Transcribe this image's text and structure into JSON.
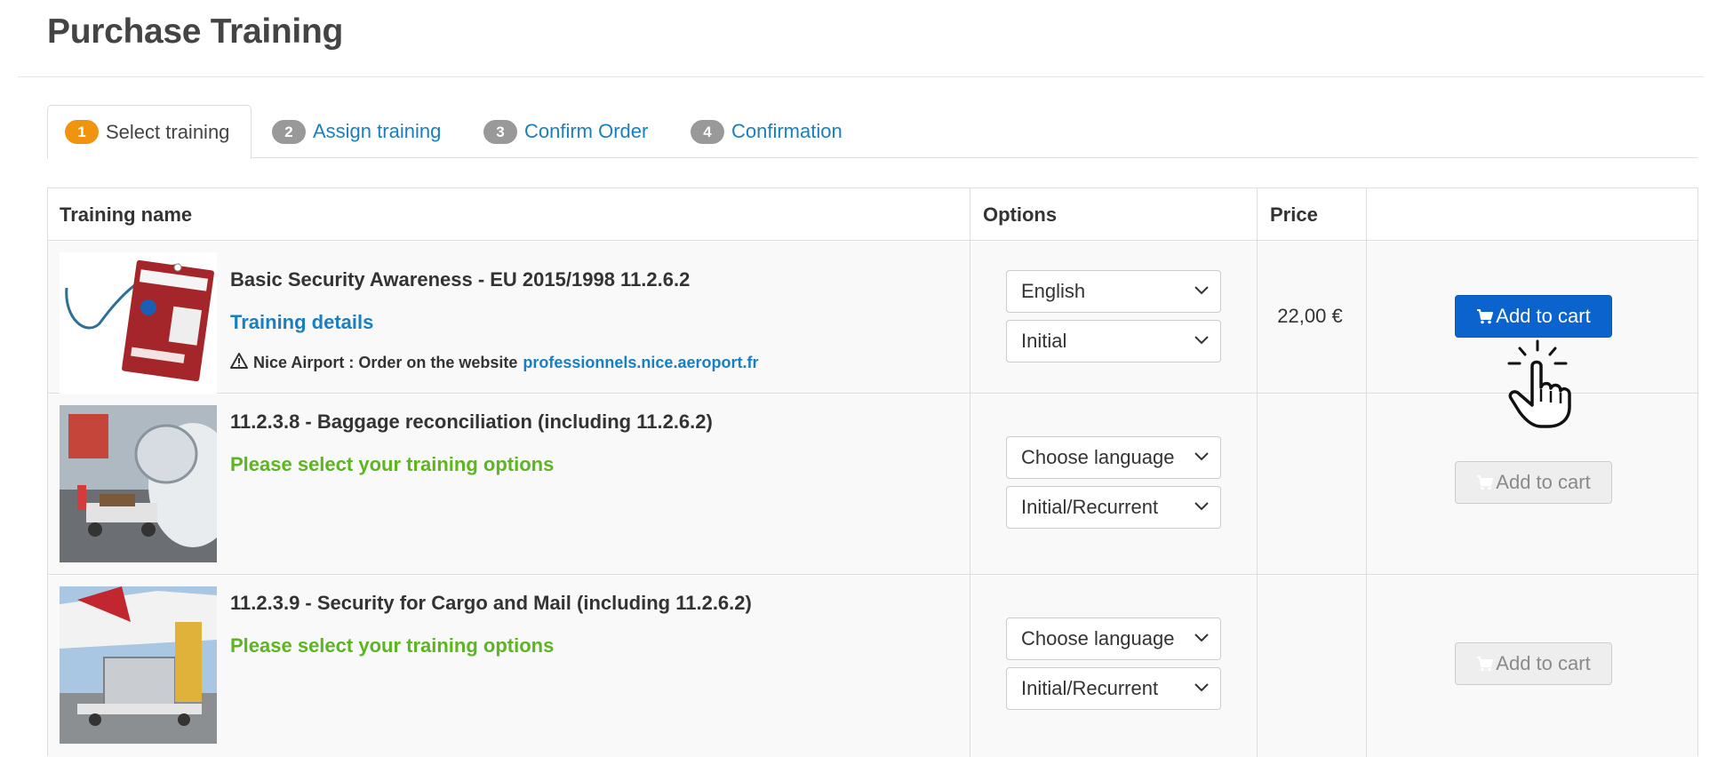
{
  "page": {
    "title": "Purchase Training"
  },
  "tabs": [
    {
      "num": "1",
      "label": "Select training",
      "active": true
    },
    {
      "num": "2",
      "label": "Assign training"
    },
    {
      "num": "3",
      "label": "Confirm Order"
    },
    {
      "num": "4",
      "label": "Confirmation"
    }
  ],
  "table": {
    "headers": {
      "name": "Training name",
      "options": "Options",
      "price": "Price",
      "action": ""
    },
    "rows": [
      {
        "title": "Basic Security Awareness - EU 2015/1998 11.2.6.2",
        "details_link": "Training details",
        "notice_prefix": "Nice Airport : Order on the website",
        "notice_link": "professionnels.nice.aeroport.fr",
        "language": "English",
        "type": "Initial",
        "price": "22,00 €",
        "button": "Add to cart",
        "image": "airport-badge-image"
      },
      {
        "title": "11.2.3.8 - Baggage reconciliation (including 11.2.6.2)",
        "hint": "Please select your training options",
        "language": "Choose language",
        "type": "Initial/Recurrent",
        "price": "",
        "button": "Add to cart",
        "image": "baggage-loading-image"
      },
      {
        "title": "11.2.3.9 - Security for Cargo and Mail (including 11.2.6.2)",
        "hint": "Please select your training options",
        "language": "Choose language",
        "type": "Initial/Recurrent",
        "price": "",
        "button": "Add to cart",
        "image": "cargo-loading-image"
      }
    ]
  },
  "colors": {
    "accent_link": "#1a7fc1",
    "primary_button": "#0b63ce",
    "hint_green": "#5cb521",
    "active_step": "#f0930f"
  },
  "icons": [
    "cart-icon",
    "warning-icon",
    "chevron-down-icon",
    "hand-pointer-icon"
  ]
}
